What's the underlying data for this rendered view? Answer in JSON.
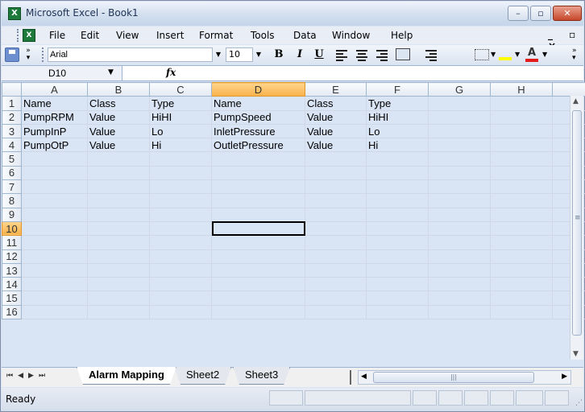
{
  "window": {
    "title": "Microsoft Excel - Book1",
    "app_icon_glyph": "X"
  },
  "menubar": {
    "items": [
      "File",
      "Edit",
      "View",
      "Insert",
      "Format",
      "Tools",
      "Data",
      "Window",
      "Help"
    ],
    "mdi_controls": "_ ▫ ×"
  },
  "toolbar": {
    "font": "Arial",
    "size": "10",
    "bold": "B",
    "italic": "I",
    "underline": "U",
    "font_color_glyph": "A"
  },
  "formula": {
    "namebox": "D10",
    "fx": "fx",
    "content": ""
  },
  "sheet": {
    "columns": [
      "A",
      "B",
      "C",
      "D",
      "E",
      "F",
      "G",
      "H"
    ],
    "selected_column": "D",
    "selected_row": "10",
    "row_numbers": [
      "1",
      "2",
      "3",
      "4",
      "5",
      "6",
      "7",
      "8",
      "9",
      "10",
      "11",
      "12",
      "13",
      "14",
      "15",
      "16"
    ],
    "rows": [
      [
        "Name",
        "Class",
        "Type",
        "Name",
        "Class",
        "Type",
        "",
        ""
      ],
      [
        "PumpRPM",
        "Value",
        "HiHI",
        "PumpSpeed",
        "Value",
        "HiHI",
        "",
        ""
      ],
      [
        "PumpInP",
        "Value",
        "Lo",
        "InletPressure",
        "Value",
        "Lo",
        "",
        ""
      ],
      [
        "PumpOtP",
        "Value",
        "Hi",
        "OutletPressure",
        "Value",
        "Hi",
        "",
        ""
      ]
    ]
  },
  "tabs": {
    "sheets": [
      "Alarm Mapping",
      "Sheet2",
      "Sheet3"
    ],
    "active": "Alarm Mapping"
  },
  "status": {
    "text": "Ready"
  },
  "colors": {
    "accent": "#1d7a3a",
    "selection_header": "#f7b24a",
    "title_bar": "#d3dfee"
  }
}
